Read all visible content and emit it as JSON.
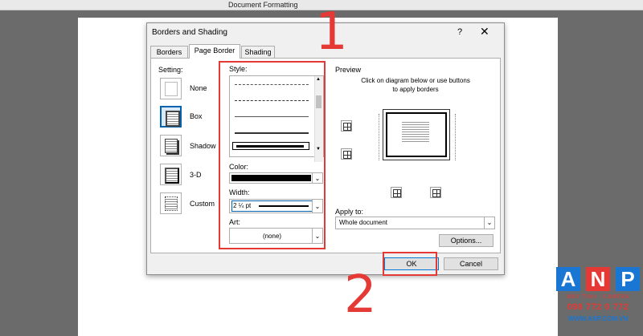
{
  "window": {
    "title": "Document Formatting"
  },
  "dialog": {
    "title": "Borders and Shading",
    "help": "?",
    "close": "✕",
    "tabs": [
      {
        "label": "Borders",
        "active": false
      },
      {
        "label": "Page Border",
        "active": true
      },
      {
        "label": "Shading",
        "active": false
      }
    ],
    "setting": {
      "label": "Setting:",
      "options": [
        "None",
        "Box",
        "Shadow",
        "3-D",
        "Custom"
      ],
      "selected": "Box"
    },
    "style": {
      "label": "Style:"
    },
    "color": {
      "label": "Color:",
      "value": "#000000"
    },
    "width": {
      "label": "Width:",
      "value": "2 ¼ pt"
    },
    "art": {
      "label": "Art:",
      "value": "(none)"
    },
    "preview": {
      "label": "Preview",
      "instructions_line1": "Click on diagram below or use buttons",
      "instructions_line2": "to apply borders"
    },
    "apply_to": {
      "label": "Apply to:",
      "value": "Whole document"
    },
    "options_button": "Options...",
    "ok_button": "OK",
    "cancel_button": "Cancel"
  },
  "annotations": {
    "step1": "1",
    "step2": "2",
    "color": "#e53935"
  },
  "logo": {
    "letters": [
      "A",
      "N",
      "P"
    ],
    "tagline": "MÁY TÍNH - CAMERA",
    "phone": "098 772 0 772",
    "website": "WWW.ANP.COM.VN",
    "colors": [
      "#1976d2",
      "#e53935",
      "#1976d2"
    ]
  }
}
